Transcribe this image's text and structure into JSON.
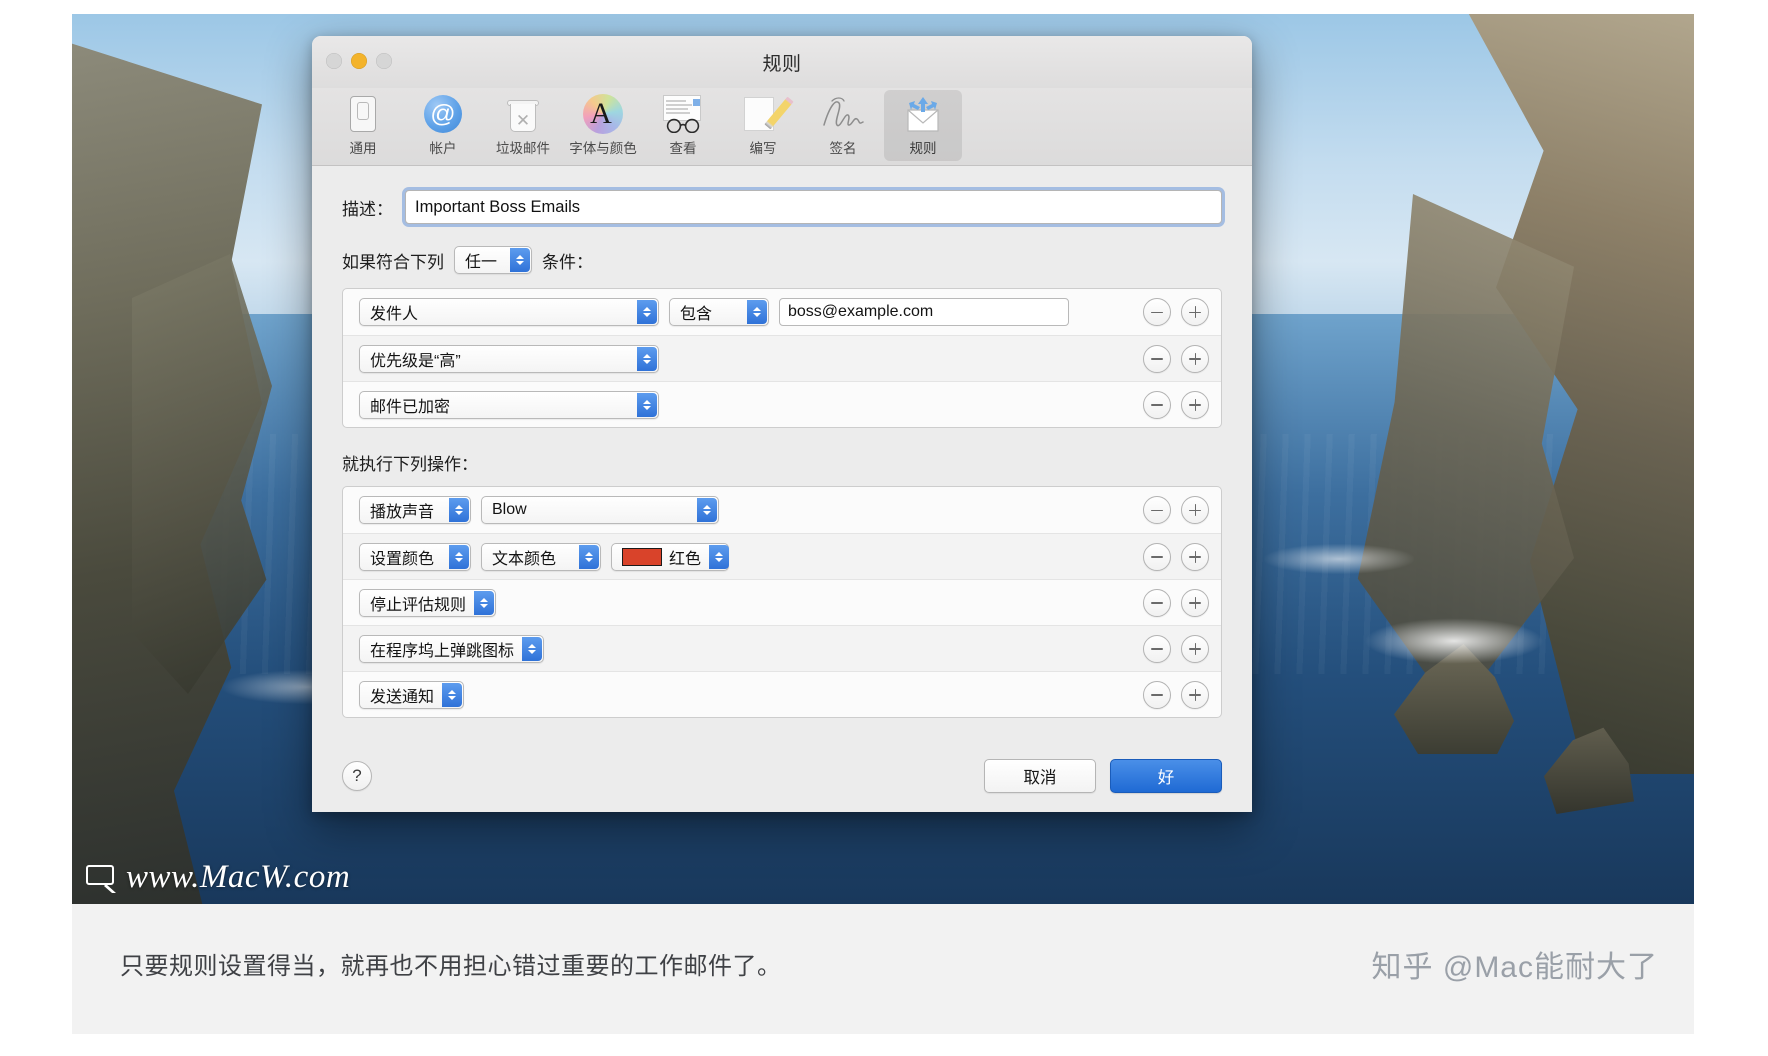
{
  "window": {
    "title": "规则",
    "traffic_lights": [
      "close",
      "minimize",
      "zoom"
    ]
  },
  "toolbar": {
    "items": [
      {
        "label": "通用",
        "icon": "general-icon",
        "selected": false
      },
      {
        "label": "帐户",
        "icon": "accounts-at-icon",
        "selected": false
      },
      {
        "label": "垃圾邮件",
        "icon": "junk-trash-icon",
        "selected": false
      },
      {
        "label": "字体与颜色",
        "icon": "fonts-colors-icon",
        "selected": false
      },
      {
        "label": "查看",
        "icon": "viewing-glasses-icon",
        "selected": false
      },
      {
        "label": "编写",
        "icon": "composing-pencil-icon",
        "selected": false
      },
      {
        "label": "签名",
        "icon": "signature-icon",
        "selected": false
      },
      {
        "label": "规则",
        "icon": "rules-envelope-icon",
        "selected": true
      }
    ]
  },
  "rule_sheet": {
    "description_label": "描述：",
    "description_value": "Important Boss Emails",
    "match_prefix": "如果符合下列",
    "match_selector": "任一",
    "match_suffix": "条件：",
    "conditions": [
      {
        "criterion": "发件人",
        "operator": "包含",
        "value": "boss@example.com",
        "has_operator": true,
        "has_value": true
      },
      {
        "criterion": "优先级是“高”",
        "has_operator": false,
        "has_value": false
      },
      {
        "criterion": "邮件已加密",
        "has_operator": false,
        "has_value": false
      }
    ],
    "actions_label": "就执行下列操作：",
    "actions": [
      {
        "action": "播放声音",
        "detail": "Blow",
        "kind": "sound"
      },
      {
        "action": "设置颜色",
        "detail": "文本颜色",
        "color_name": "红色",
        "color_hex": "#d9432a",
        "kind": "color"
      },
      {
        "action": "停止评估规则",
        "kind": "simple"
      },
      {
        "action": "在程序坞上弹跳图标",
        "kind": "simple"
      },
      {
        "action": "发送通知",
        "kind": "simple"
      }
    ],
    "row_buttons": {
      "remove": "−",
      "add": "+"
    },
    "help_label": "?",
    "cancel_label": "取消",
    "ok_label": "好"
  },
  "caption": {
    "text": "只要规则设置得当，就再也不用担心错过重要的工作邮件了。",
    "zhihu_watermark": "知乎 @Mac能耐大了",
    "macw_watermark": "www.MacW.com"
  },
  "colors": {
    "accent_blue": "#2f72d8",
    "ok_button": "#1f6ad4",
    "focus_ring": "#6998db",
    "red_swatch": "#d9432a"
  }
}
